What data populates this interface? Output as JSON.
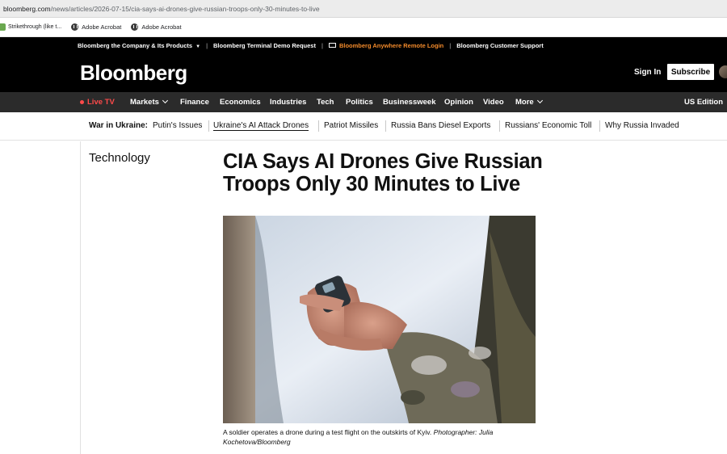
{
  "browser": {
    "url_domain": "bloomberg.com",
    "url_path": "/news/articles/2026-07-15/cia-says-ai-drones-give-russian-troops-only-30-minutes-to-live",
    "bookmarks": [
      {
        "label": "Strikethrough (like t...",
        "icon": "strikethrough-icon"
      },
      {
        "label": "Adobe Acrobat",
        "icon": "acrobat-icon"
      },
      {
        "label": "Adobe Acrobat",
        "icon": "acrobat-icon"
      }
    ]
  },
  "topbar": {
    "company": "Bloomberg the Company & Its Products",
    "terminal_demo": "Bloomberg Terminal Demo Request",
    "anywhere": "Bloomberg Anywhere Remote Login",
    "support": "Bloomberg Customer Support"
  },
  "brand": {
    "logo": "Bloomberg",
    "sign_in": "Sign In",
    "subscribe": "Subscribe"
  },
  "nav": {
    "live_tv": "Live TV",
    "items": [
      "Markets",
      "Finance",
      "Economics",
      "Industries",
      "Tech",
      "Politics",
      "Businessweek",
      "Opinion",
      "Video",
      "More"
    ],
    "edition": "US Edition"
  },
  "ukraine_bar": {
    "heading": "War in Ukraine:",
    "links": [
      "Putin's Issues",
      "Ukraine's AI Attack Drones",
      "Patriot Missiles",
      "Russia Bans Diesel Exports",
      "Russians' Economic Toll",
      "Why Russia Invaded"
    ]
  },
  "article": {
    "section": "Technology",
    "headline": "CIA Says AI Drones Give Russian Troops Only 30 Minutes to Live",
    "caption": "A soldier operates a drone during a test flight on the outskirts of Kyiv.",
    "credit": "Photographer: Julia Kochetova/Bloomberg"
  },
  "colors": {
    "accent_orange": "#f28a2b",
    "live_red": "#ff4a4a",
    "nav_bg": "#2b2b2b"
  }
}
